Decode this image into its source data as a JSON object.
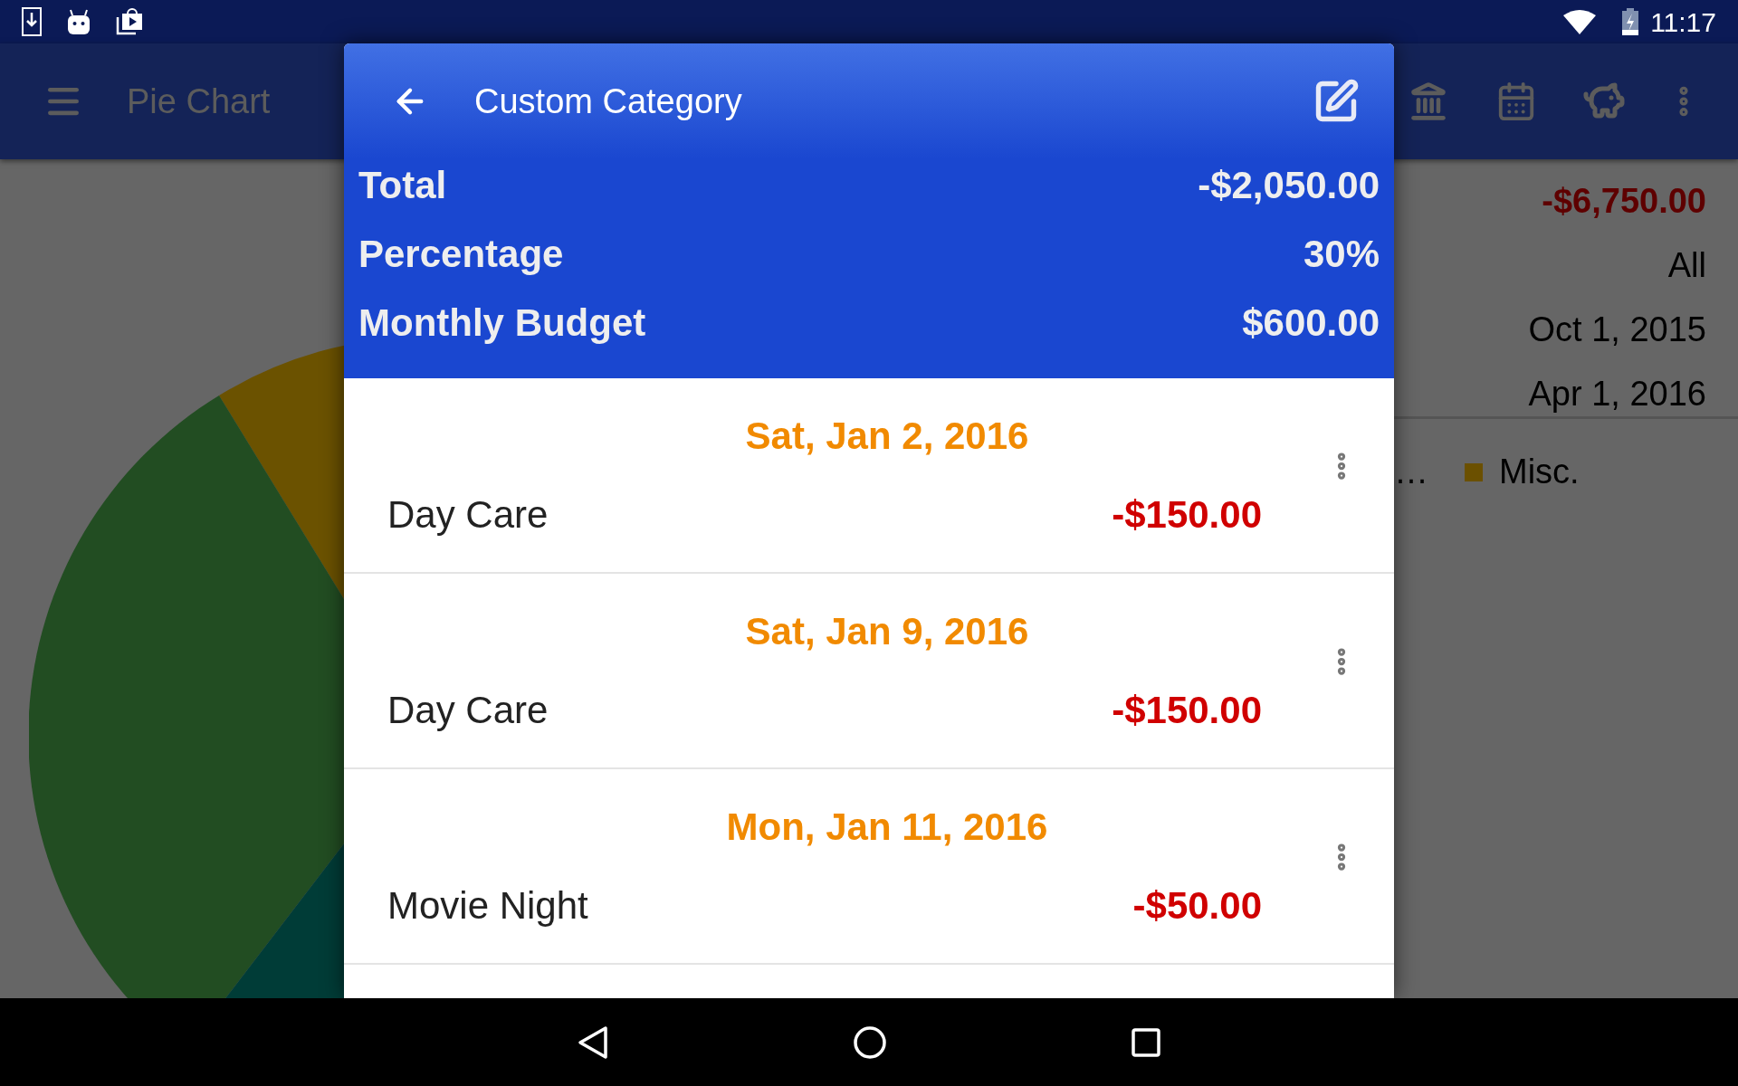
{
  "status_bar": {
    "time": "11:17"
  },
  "app_bar": {
    "title": "Pie Chart"
  },
  "summary": {
    "total": "-$6,750.00",
    "period": "All",
    "start_date": "Oct 1, 2015",
    "end_date": "Apr 1, 2016"
  },
  "legend": [
    {
      "label": "…"
    },
    {
      "label": "Misc.",
      "color": "#6b5000"
    }
  ],
  "dialog": {
    "title": "Custom Category",
    "stats": [
      {
        "label": "Total",
        "value": "-$2,050.00"
      },
      {
        "label": "Percentage",
        "value": "30%"
      },
      {
        "label": "Monthly Budget",
        "value": "$600.00"
      }
    ],
    "transactions": [
      {
        "date": "Sat, Jan 2, 2016",
        "name": "Day Care",
        "amount": "-$150.00"
      },
      {
        "date": "Sat, Jan 9, 2016",
        "name": "Day Care",
        "amount": "-$150.00"
      },
      {
        "date": "Mon, Jan 11, 2016",
        "name": "Movie Night",
        "amount": "-$50.00"
      }
    ]
  }
}
